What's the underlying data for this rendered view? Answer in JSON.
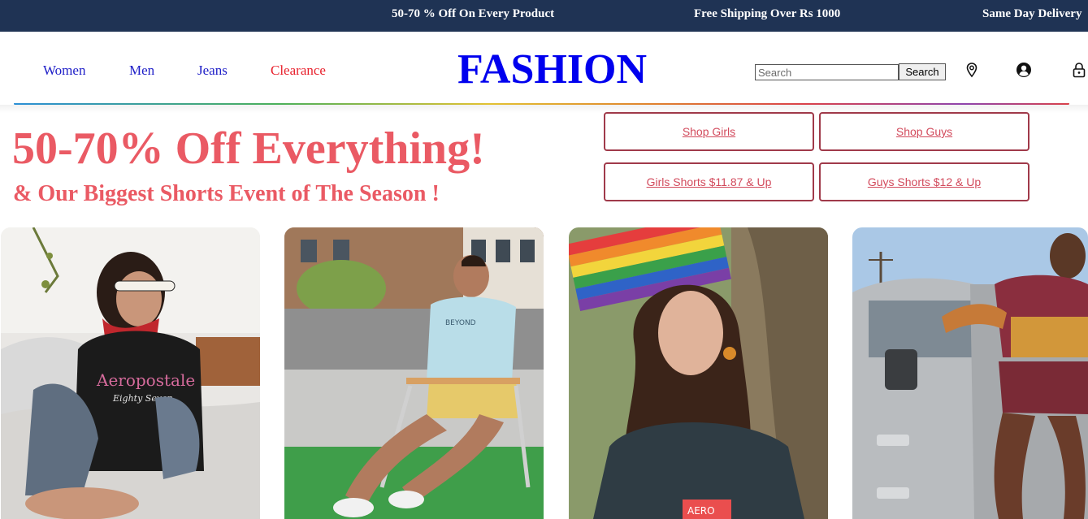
{
  "promo_bar": {
    "items": [
      "50-70 % Off On Every Product",
      "Free Shipping Over Rs 1000",
      "Same Day Delivery"
    ]
  },
  "header": {
    "nav": [
      "Women",
      "Men",
      "Jeans",
      "Clearance"
    ],
    "logo": "FASHION",
    "search": {
      "placeholder": "Search",
      "value": "",
      "button_label": "Search"
    },
    "icons": [
      "location-pin-icon",
      "user-account-icon",
      "lock-icon"
    ]
  },
  "hero": {
    "title": "50-70% Off Everything!",
    "subtitle": "& Our Biggest Shorts Event of The Season !",
    "buttons": [
      "Shop Girls",
      "Shop Guys",
      "Girls Shorts $11.87 & Up",
      "Guys Shorts $12 & Up"
    ]
  },
  "colors": {
    "promo_bar_bg": "#1f3354",
    "logo": "#0000ee",
    "nav_link": "#2020c8",
    "clearance": "#e8202c",
    "hero_text": "#ea5a64",
    "button_border": "#a03a4a"
  }
}
